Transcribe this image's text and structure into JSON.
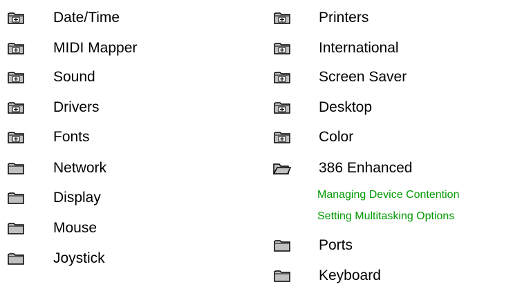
{
  "left_column": [
    {
      "label": "Date/Time",
      "icon": "folder-plus-icon"
    },
    {
      "label": "MIDI Mapper",
      "icon": "folder-plus-icon"
    },
    {
      "label": "Sound",
      "icon": "folder-plus-icon"
    },
    {
      "label": "Drivers",
      "icon": "folder-plus-icon"
    },
    {
      "label": "Fonts",
      "icon": "folder-plus-icon"
    },
    {
      "label": "Network",
      "icon": "folder-icon"
    },
    {
      "label": "Display",
      "icon": "folder-icon"
    },
    {
      "label": "Mouse",
      "icon": "folder-icon"
    },
    {
      "label": "Joystick",
      "icon": "folder-icon"
    }
  ],
  "right_column": [
    {
      "label": "Printers",
      "icon": "folder-plus-icon"
    },
    {
      "label": "International",
      "icon": "folder-plus-icon"
    },
    {
      "label": "Screen Saver",
      "icon": "folder-plus-icon"
    },
    {
      "label": "Desktop",
      "icon": "folder-plus-icon"
    },
    {
      "label": "Color",
      "icon": "folder-plus-icon"
    },
    {
      "label": "386 Enhanced",
      "icon": "folder-open-icon"
    },
    {
      "label": "Ports",
      "icon": "folder-icon"
    },
    {
      "label": "Keyboard",
      "icon": "folder-icon"
    }
  ],
  "open_topic_subitems": [
    "Managing Device Contention",
    "Setting Multitasking Options"
  ],
  "colors": {
    "subitem_link": "#009900",
    "folder_fill": "#c0c0c0",
    "folder_outline": "#000000"
  }
}
